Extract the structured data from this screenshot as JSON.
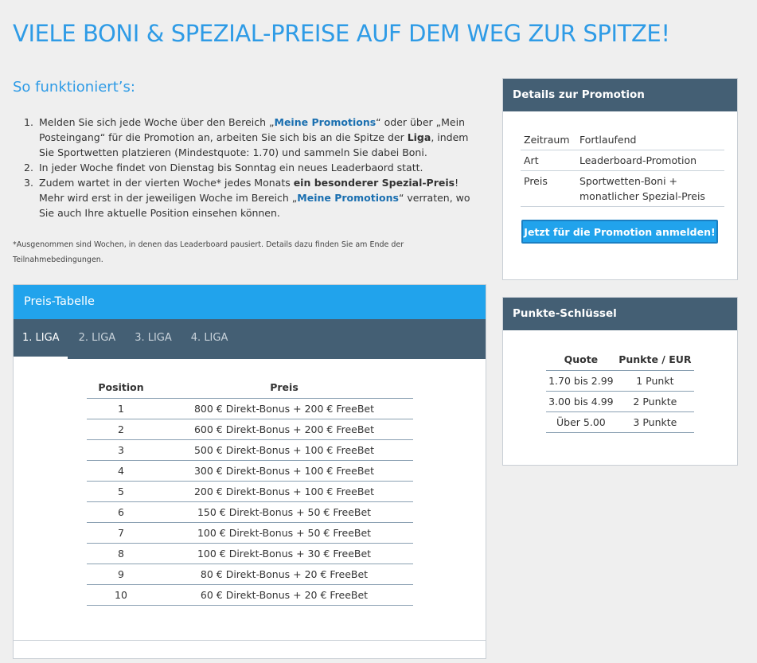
{
  "page_title": "VIELE BONI & SPEZIAL-PREISE AUF DEM WEG ZUR SPITZE!",
  "how_it_works": {
    "title": "So funktioniert’s:",
    "step1": {
      "num": "1.",
      "t1": "Melden Sie sich jede Woche über den Bereich „",
      "link1": "Meine Promotions",
      "t2": "“ oder über „Mein Posteingang“ für die Promotion an, arbeiten Sie sich bis an die Spitze der ",
      "bold1": "Liga",
      "t3": ", indem Sie Sportwetten platzieren (Mindestquote: 1.70) und sammeln Sie dabei Boni."
    },
    "step2": {
      "num": "2.",
      "text": "In jeder Woche findet von Dienstag bis Sonntag ein neues Leaderbaord statt."
    },
    "step3": {
      "num": "3.",
      "t1": "Zudem wartet in der vierten Woche* jedes Monats ",
      "bold1": "ein besonderer Spezial-Preis",
      "t2": "! Mehr wird erst in der jeweiligen Woche im Bereich „",
      "link1": "Meine Promotions",
      "t3": "“ verraten, wo Sie auch Ihre aktuelle Position einsehen können."
    },
    "footnote": "*Ausgenommen sind Wochen, in denen das Leaderboard pausiert. Details dazu finden Sie am Ende der Teilnahmebedingungen."
  },
  "prize_table": {
    "title": "Preis-Tabelle",
    "tabs": [
      "1. LIGA",
      "2. LIGA",
      "3. LIGA",
      "4. LIGA"
    ],
    "active_tab": 0,
    "headers": {
      "position": "Position",
      "prize": "Preis"
    },
    "rows": [
      {
        "position": "1",
        "prize": "800 € Direkt-Bonus + 200 € FreeBet"
      },
      {
        "position": "2",
        "prize": "600 € Direkt-Bonus + 200 € FreeBet"
      },
      {
        "position": "3",
        "prize": "500 € Direkt-Bonus + 100 € FreeBet"
      },
      {
        "position": "4",
        "prize": "300 € Direkt-Bonus + 100 € FreeBet"
      },
      {
        "position": "5",
        "prize": "200 € Direkt-Bonus + 100 € FreeBet"
      },
      {
        "position": "6",
        "prize": "150 € Direkt-Bonus + 50 € FreeBet"
      },
      {
        "position": "7",
        "prize": "100 € Direkt-Bonus + 50 € FreeBet"
      },
      {
        "position": "8",
        "prize": "100 € Direkt-Bonus + 30 € FreeBet"
      },
      {
        "position": "9",
        "prize": "80 € Direkt-Bonus + 20 € FreeBet"
      },
      {
        "position": "10",
        "prize": "60 € Direkt-Bonus + 20 € FreeBet"
      }
    ]
  },
  "details": {
    "title": "Details zur Promotion",
    "rows": [
      {
        "key": "Zeitraum",
        "value": "Fortlaufend"
      },
      {
        "key": "Art",
        "value": "Leaderboard-Promotion"
      },
      {
        "key": "Preis",
        "value": "Sportwetten-Boni + monatlicher Spezial-Preis"
      }
    ],
    "cta_label": "Jetzt für die Promotion anmelden!"
  },
  "points_key": {
    "title": "Punkte-Schlüssel",
    "headers": {
      "odds": "Quote",
      "points": "Punkte / EUR"
    },
    "rows": [
      {
        "odds": "1.70 bis 2.99",
        "points": "1 Punkt"
      },
      {
        "odds": "3.00 bis 4.99",
        "points": "2 Punkte"
      },
      {
        "odds": "Über 5.00",
        "points": "3 Punkte"
      }
    ]
  },
  "colors": {
    "accent_blue": "#21a3ec",
    "title_blue": "#2e9be6",
    "header_slate": "#445f74",
    "background": "#efefef"
  }
}
